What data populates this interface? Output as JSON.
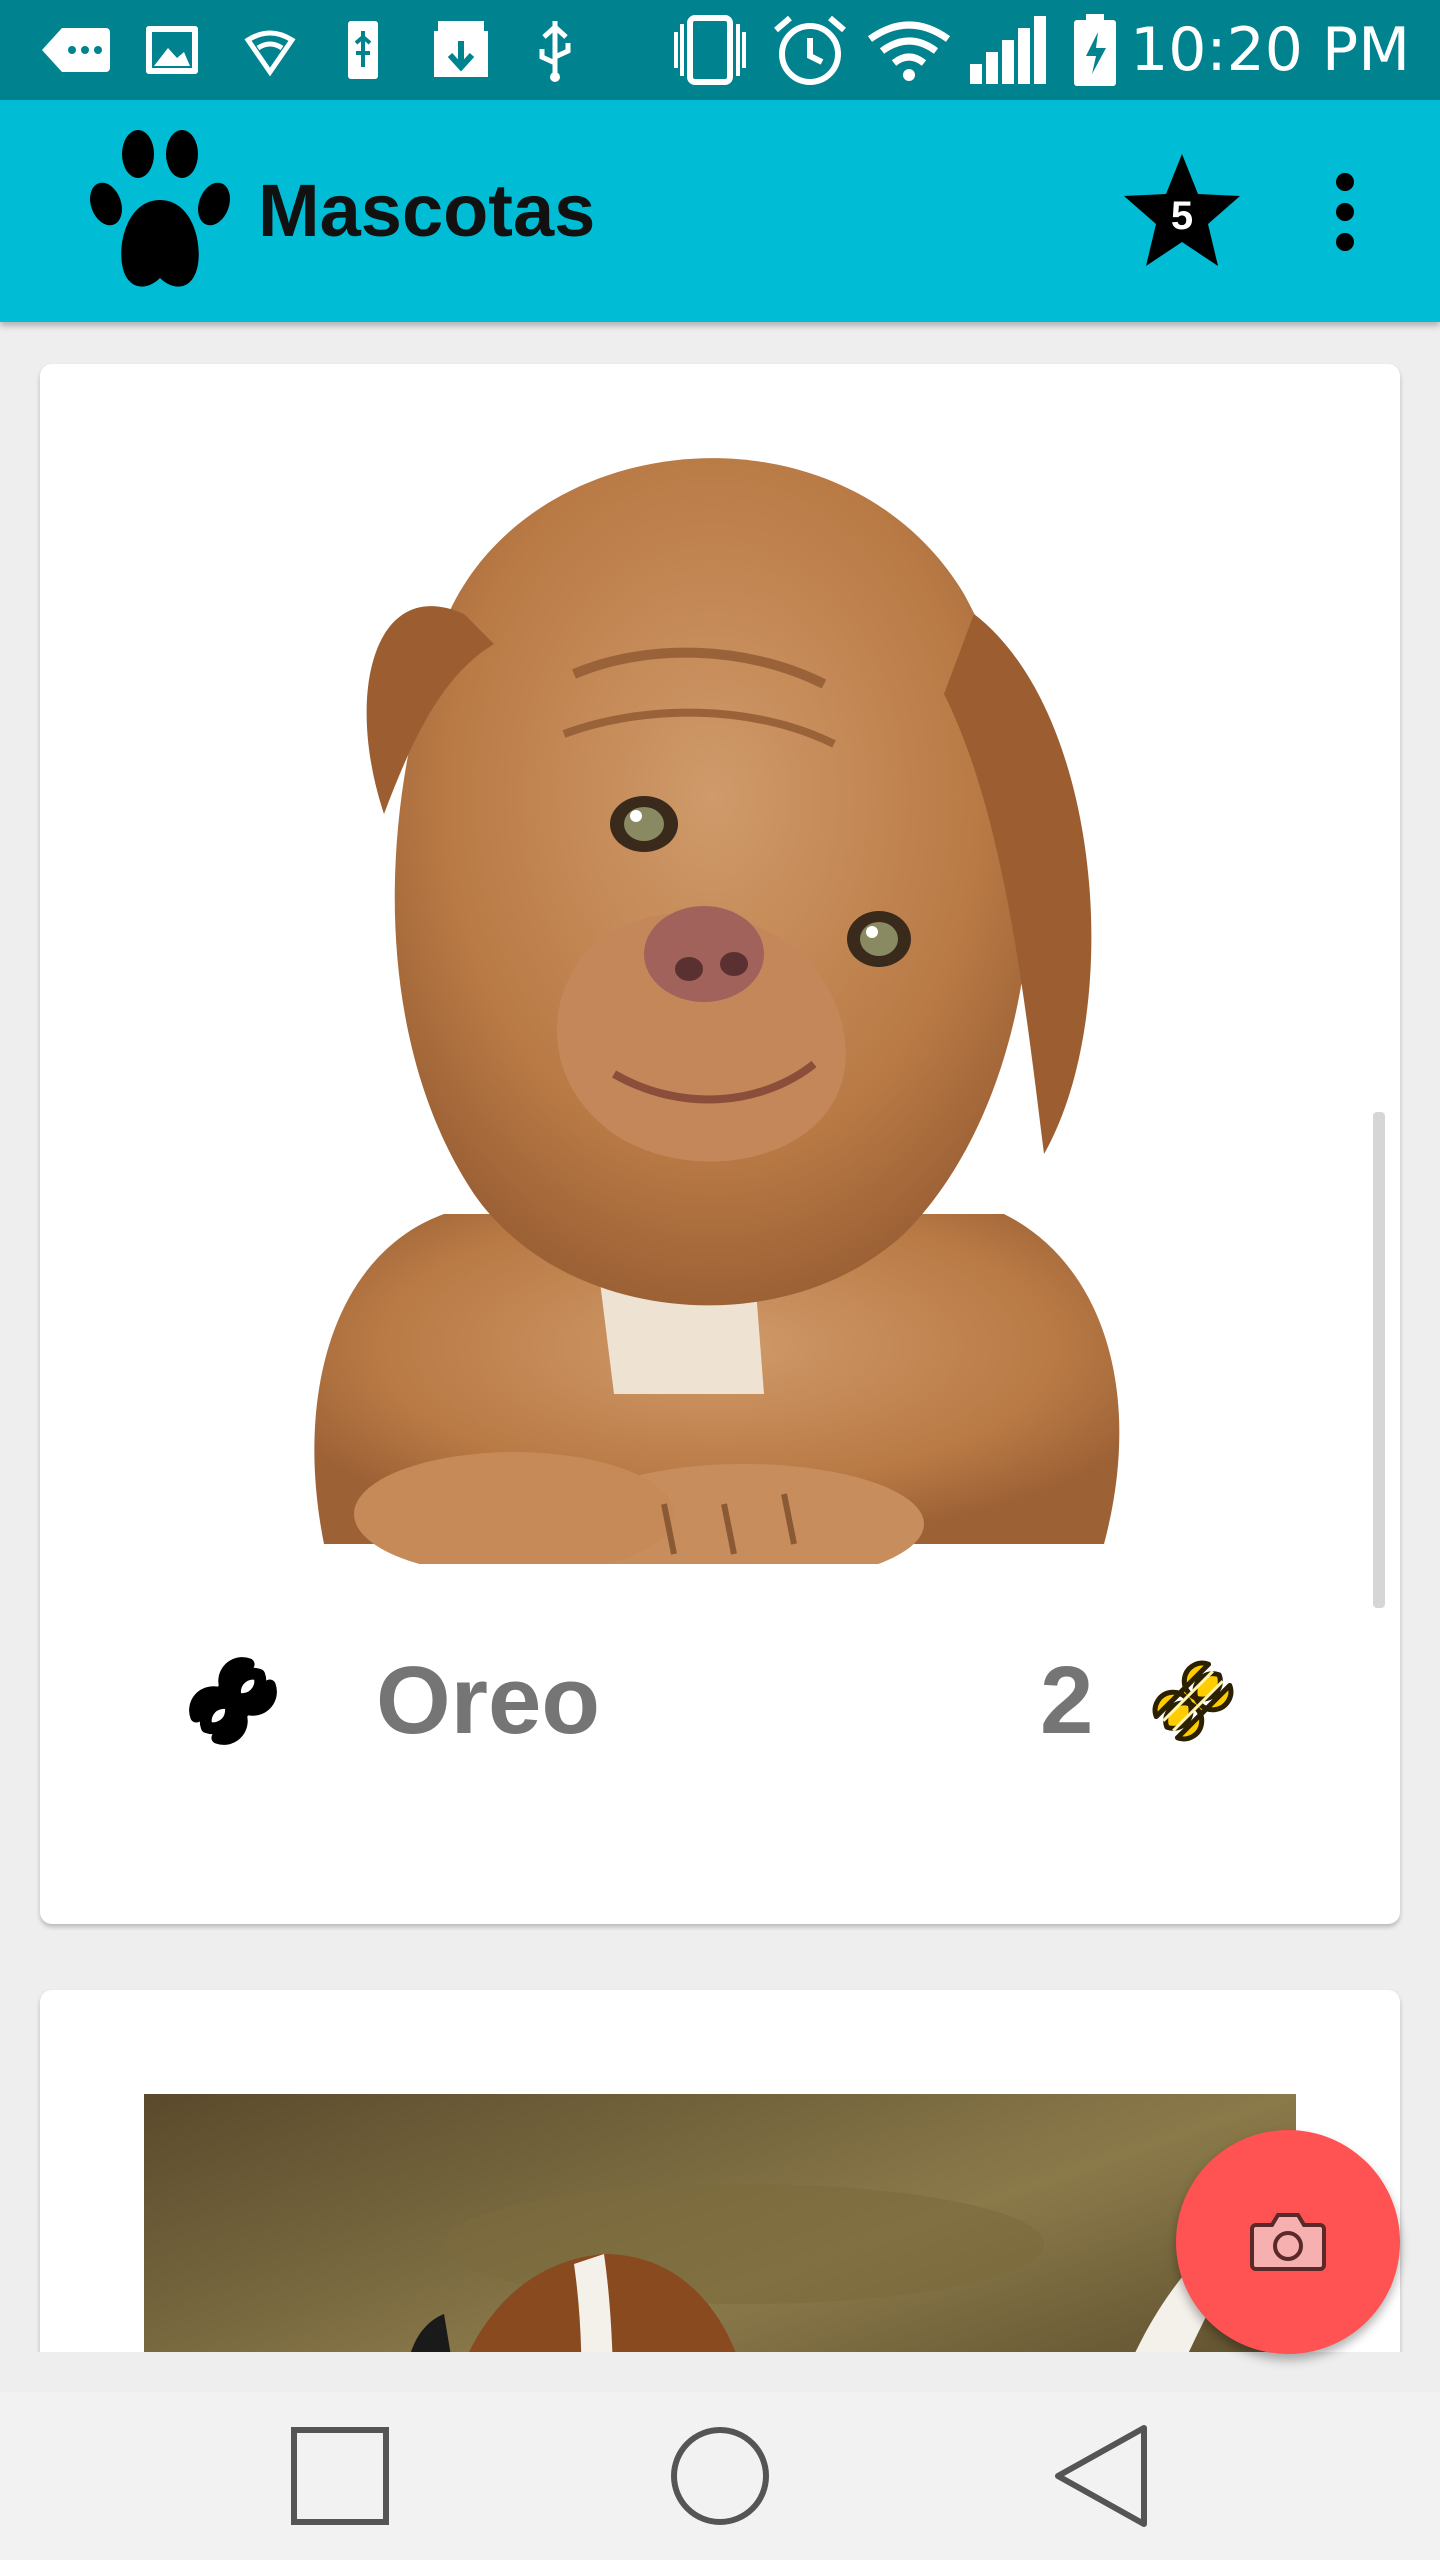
{
  "status_bar": {
    "time": "10:20 PM",
    "icons": [
      "more-notifications-icon",
      "image-icon",
      "vpn-wifi-icon",
      "usb-icon",
      "download-icon",
      "usb-icon",
      "vibrate-icon",
      "alarm-icon",
      "wifi-icon",
      "signal-icon",
      "battery-charging-icon"
    ]
  },
  "app_bar": {
    "title": "Mascotas",
    "logo_icon": "paw-icon",
    "favorites_icon": "star-icon",
    "favorites_count": "5",
    "menu_icon": "overflow-menu-icon"
  },
  "pets": [
    {
      "name": "Oreo",
      "rating": "2",
      "rate_icon": "bone-outline-icon",
      "rating_icon": "bone-filled-icon",
      "photo": "brown-puppy-photo"
    },
    {
      "photo": "beagle-photo"
    }
  ],
  "fab": {
    "icon": "camera-icon"
  },
  "nav_bar": {
    "icons": [
      "recents-icon",
      "home-icon",
      "back-icon"
    ]
  },
  "colors": {
    "status_bar": "#00838f",
    "app_bar": "#00bcd4",
    "fab": "#ff5252",
    "rating_bone": "#ffcc00",
    "text_gray": "#757575"
  }
}
